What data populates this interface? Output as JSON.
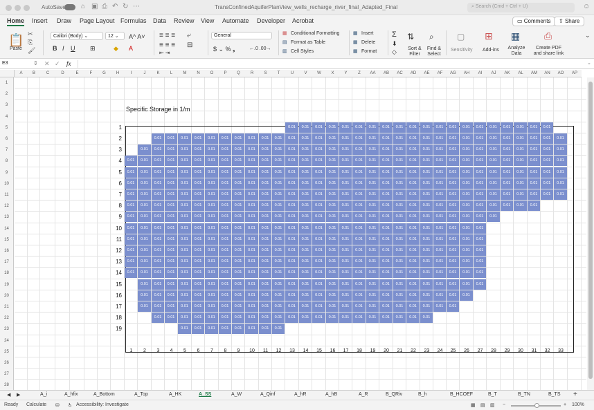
{
  "window": {
    "autosave_label": "AutoSave",
    "title": "TransConfinedAquiferPlanView_wells_recharge_river_final_Adapted_Final",
    "search_placeholder": "Search (Cmd + Ctrl + U)"
  },
  "menu": {
    "items": [
      "Home",
      "Insert",
      "Draw",
      "Page Layout",
      "Formulas",
      "Data",
      "Review",
      "View",
      "Automate",
      "Developer",
      "Acrobat"
    ],
    "comments_label": "Comments",
    "share_label": "Share"
  },
  "ribbon": {
    "paste": "Paste",
    "font_name": "Calibri (Body)",
    "font_size": "12",
    "number_format": "General",
    "conditional_formatting": "Conditional Formatting",
    "format_as_table": "Format as Table",
    "cell_styles": "Cell Styles",
    "insert": "Insert",
    "delete": "Delete",
    "format": "Format",
    "sort_filter": "Sort & Filter",
    "find_select": "Find & Select",
    "sensitivity": "Sensitivity",
    "addins": "Add-ins",
    "analyze_data": "Analyze Data",
    "create_pdf": "Create PDF and share link"
  },
  "formula_bar": {
    "name_box": "E3",
    "fx": "fx",
    "value": ""
  },
  "columns": [
    "A",
    "B",
    "C",
    "D",
    "E",
    "F",
    "G",
    "H",
    "I",
    "J",
    "K",
    "L",
    "M",
    "N",
    "O",
    "P",
    "Q",
    "R",
    "S",
    "T",
    "U",
    "V",
    "W",
    "X",
    "Y",
    "Z",
    "AA",
    "AB",
    "AC",
    "AD",
    "AE",
    "AF",
    "AG",
    "AH",
    "AI",
    "AJ",
    "AK",
    "AL",
    "AM",
    "AN",
    "AO",
    "AP"
  ],
  "sheet": {
    "title": "Specific Storage in 1/m",
    "cell_value": "0.01",
    "row_labels": [
      "1",
      "2",
      "3",
      "4",
      "5",
      "6",
      "7",
      "8",
      "9",
      "10",
      "11",
      "12",
      "13",
      "14",
      "15",
      "16",
      "17",
      "18",
      "19"
    ],
    "col_labels": [
      "1",
      "2",
      "3",
      "4",
      "5",
      "6",
      "7",
      "8",
      "9",
      "10",
      "11",
      "12",
      "13",
      "14",
      "15",
      "16",
      "17",
      "18",
      "19",
      "20",
      "21",
      "22",
      "23",
      "24",
      "25",
      "26",
      "27",
      "28",
      "29",
      "30",
      "31",
      "32",
      "33"
    ],
    "active_ranges": [
      [
        13,
        32
      ],
      [
        3,
        33
      ],
      [
        2,
        33
      ],
      [
        1,
        33
      ],
      [
        1,
        33
      ],
      [
        1,
        33
      ],
      [
        1,
        33
      ],
      [
        1,
        31
      ],
      [
        1,
        28
      ],
      [
        1,
        27
      ],
      [
        1,
        27
      ],
      [
        1,
        27
      ],
      [
        1,
        27
      ],
      [
        1,
        27
      ],
      [
        2,
        27
      ],
      [
        2,
        26
      ],
      [
        2,
        25
      ],
      [
        3,
        23
      ],
      [
        5,
        12
      ]
    ]
  },
  "tabs": [
    "A_i",
    "A_hfix",
    "A_Bottom",
    "A_Top",
    "A_HK",
    "A_SS",
    "A_W",
    "A_Qinf",
    "A_hR",
    "A_hB",
    "A_R",
    "B_QRiv",
    "B_h",
    "B_HCOEF",
    "B_T",
    "B_TN",
    "B_TS"
  ],
  "active_tab": "A_SS",
  "status": {
    "ready": "Ready",
    "calculate": "Calculate",
    "accessibility": "Accessibility: Investigate",
    "zoom": "100%"
  }
}
